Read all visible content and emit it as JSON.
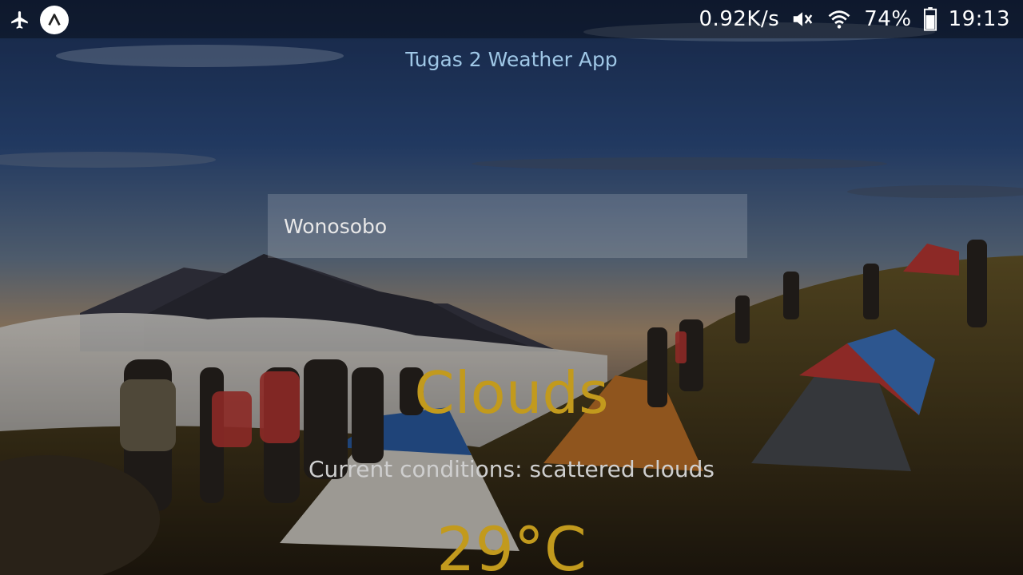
{
  "status_bar": {
    "network_speed": "0.92K/s",
    "battery_percent": "74%",
    "time": "19:13",
    "icons": {
      "left": [
        "airplane-icon",
        "notification-app-icon"
      ],
      "right": [
        "mute-icon",
        "wifi-icon",
        "battery-icon"
      ]
    },
    "battery_level": 0.74
  },
  "app": {
    "title": "Tugas 2 Weather App"
  },
  "search": {
    "city_value": "Wonosobo"
  },
  "weather": {
    "main": "Clouds",
    "description": "Current conditions: scattered clouds",
    "temperature": "29°C"
  },
  "colors": {
    "accent": "#c29a1d",
    "title": "#9fc7e6",
    "description": "#cfcfcf"
  }
}
